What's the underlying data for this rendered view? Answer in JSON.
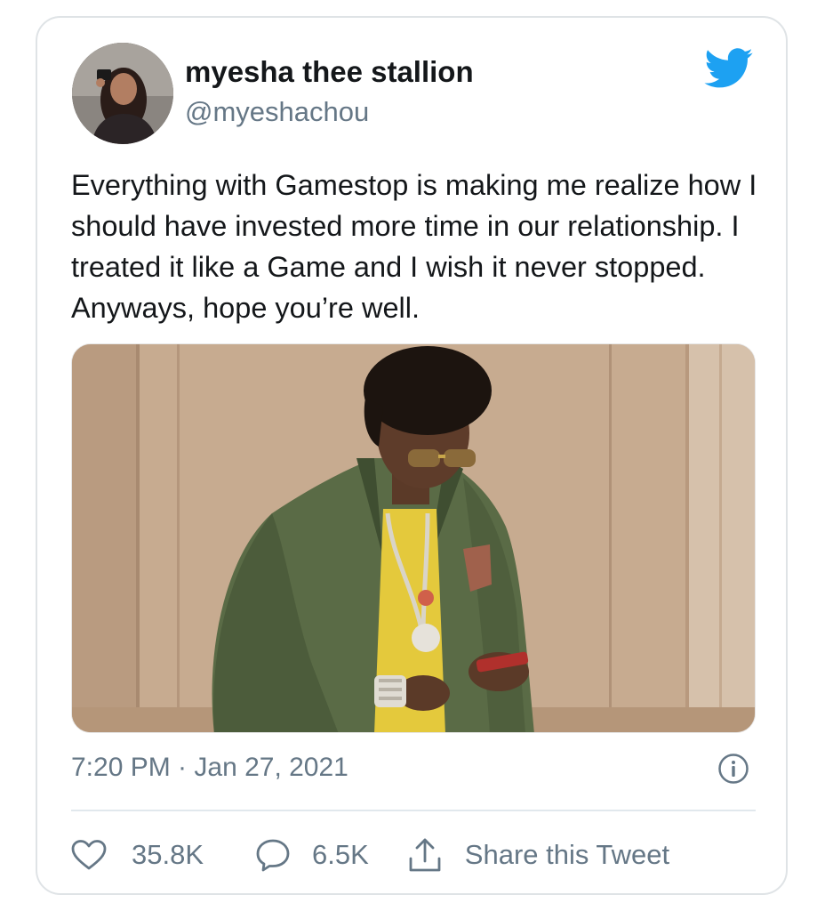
{
  "tweet": {
    "author_name": "myesha thee stallion",
    "author_handle": "@myeshachou",
    "text": "Everything with Gamestop is making me realize how I should have invested more time in our relationship. I treated it like a Game and I wish it never stopped. Anyways, hope you’re well.",
    "timestamp": "7:20 PM · Jan 27, 2021",
    "like_count": "35.8K",
    "reply_count": "6.5K",
    "share_label": "Share this Tweet"
  },
  "icons": {
    "logo": "twitter-bird-icon",
    "info": "info-icon",
    "like": "heart-icon",
    "reply": "speech-bubble-icon",
    "share": "share-upload-icon"
  },
  "colors": {
    "brand": "#1da1f2",
    "text": "#14171a",
    "secondary": "#657786",
    "border": "#dfe3e6"
  }
}
